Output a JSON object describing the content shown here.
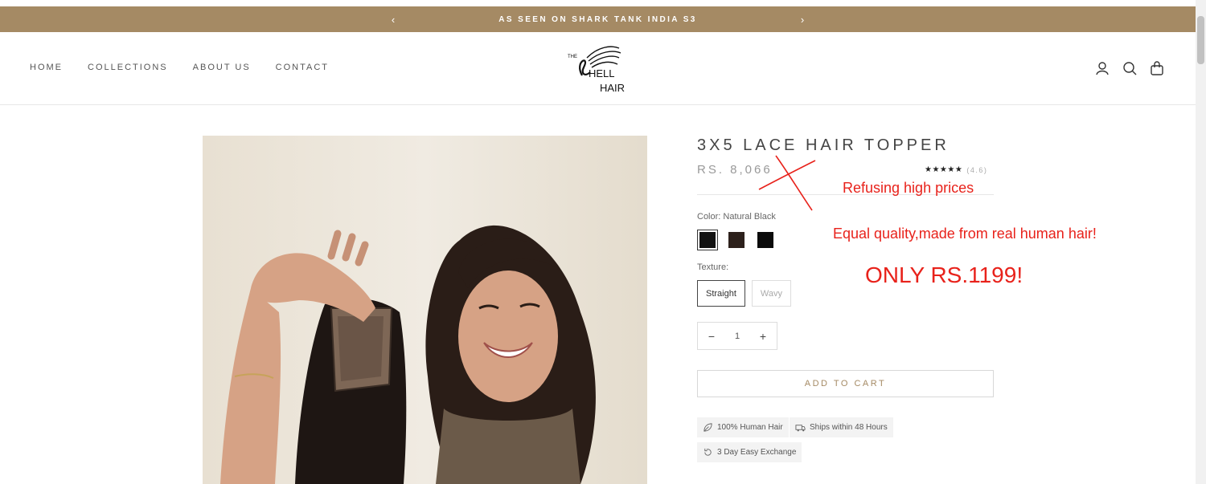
{
  "announcement": {
    "text": "AS SEEN ON SHARK TANK INDIA S3",
    "prev_icon": "chevron-left-icon",
    "next_icon": "chevron-right-icon"
  },
  "nav": {
    "items": [
      "HOME",
      "COLLECTIONS",
      "ABOUT US",
      "CONTACT"
    ]
  },
  "logo": {
    "lines": [
      "THE",
      "HELL",
      "HAIR"
    ]
  },
  "header_icons": [
    "account-icon",
    "search-icon",
    "cart-icon"
  ],
  "product": {
    "title": "3X5 LACE HAIR TOPPER",
    "price": "RS. 8,066",
    "rating_stars": "★★★★★",
    "rating_value": "(4.6)",
    "color_label": "Color: Natural Black",
    "swatches": [
      {
        "color": "#121212",
        "selected": true
      },
      {
        "color": "#2d211c",
        "selected": false
      },
      {
        "color": "#0b0b0b",
        "selected": false
      }
    ],
    "texture_label": "Texture:",
    "textures": [
      {
        "label": "Straight",
        "selected": true
      },
      {
        "label": "Wavy",
        "selected": false
      }
    ],
    "quantity": "1",
    "minus": "−",
    "plus": "+",
    "add_to_cart": "ADD TO CART",
    "badges": [
      "100% Human Hair",
      "Ships within 48 Hours",
      "3 Day Easy Exchange"
    ]
  },
  "annotations": {
    "line1": "Refusing high prices",
    "line2": "Equal quality,made from real human hair!",
    "line3": "ONLY RS.1199!"
  },
  "colors": {
    "brand": "#a58a64",
    "annotation": "#e8221b"
  }
}
